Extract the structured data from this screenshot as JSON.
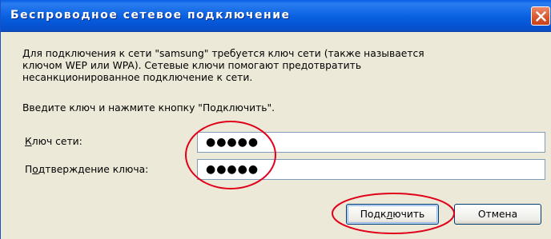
{
  "window": {
    "title": "Беспроводное сетевое подключение",
    "close_icon": "close-icon"
  },
  "message": {
    "line1": "Для подключения к сети \"samsung\" требуется ключ сети (также называется",
    "line2": "ключом WEP или WPA). Сетевые ключи помогают предотвратить",
    "line3": "несанкционированное подключение к сети.",
    "instruction": "Введите ключ и нажмите кнопку \"Подключить\"."
  },
  "form": {
    "key_label_accel": "К",
    "key_label_rest": "люч сети:",
    "key_value": "●●●●●",
    "confirm_label_pre": "П",
    "confirm_label_accel": "о",
    "confirm_label_rest": "дтверждение ключа:",
    "confirm_value": "●●●●●"
  },
  "buttons": {
    "connect_pre": "Подк",
    "connect_accel": "л",
    "connect_rest": "ючить",
    "cancel": "Отмена"
  },
  "colors": {
    "titlebar": "#0a5ee6",
    "dialog_bg": "#ece9d8",
    "annotation": "#e0001a"
  }
}
